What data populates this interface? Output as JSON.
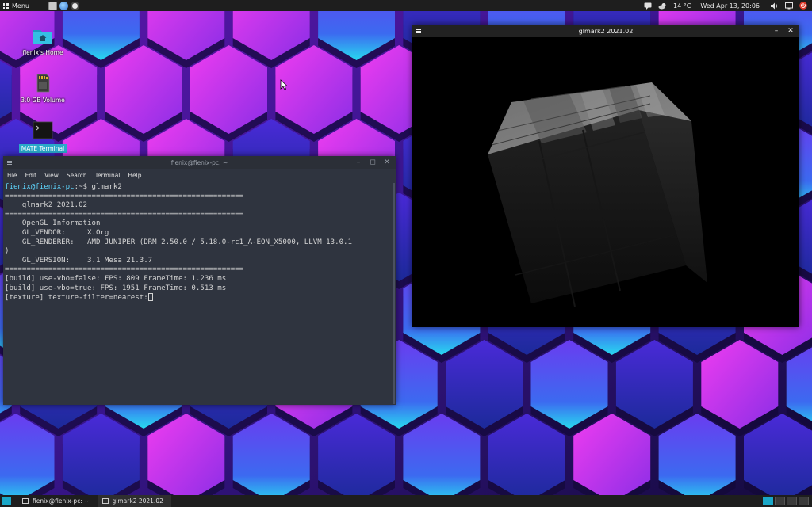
{
  "top_panel": {
    "menu_label": "Menu",
    "temperature": "14 °C",
    "clock": "Wed Apr 13, 20:06"
  },
  "desktop": {
    "icons": [
      {
        "label": "fienix's Home"
      },
      {
        "label": "3.0 GB Volume"
      },
      {
        "label": "MATE Terminal"
      }
    ]
  },
  "terminal": {
    "title": "fienix@fienix-pc: ~",
    "menus": [
      "File",
      "Edit",
      "View",
      "Search",
      "Terminal",
      "Help"
    ],
    "prompt_user": "fienix@fienix-pc",
    "prompt_rest": ":~$ glmark2",
    "lines": [
      "=======================================================",
      "    glmark2 2021.02",
      "=======================================================",
      "    OpenGL Information",
      "    GL_VENDOR:     X.Org",
      "    GL_RENDERER:   AMD JUNIPER (DRM 2.50.0 / 5.18.0-rc1_A-EON_X5000, LLVM 13.0.1",
      ")",
      "    GL_VERSION:    3.1 Mesa 21.3.7",
      "=======================================================",
      "[build] use-vbo=false: FPS: 809 FrameTime: 1.236 ms",
      "[build] use-vbo=true: FPS: 1951 FrameTime: 0.513 ms"
    ],
    "current_line": "[texture] texture-filter=nearest:"
  },
  "glmark_window": {
    "title": "glmark2 2021.02"
  },
  "taskbar": {
    "tasks": [
      {
        "label": "fienix@fienix-pc: ~"
      },
      {
        "label": "glmark2 2021.02"
      }
    ]
  },
  "colors": {
    "accent": "#1aa7c8",
    "terminal_bg": "#2f343f",
    "panel_bg": "#1e1e1e"
  }
}
